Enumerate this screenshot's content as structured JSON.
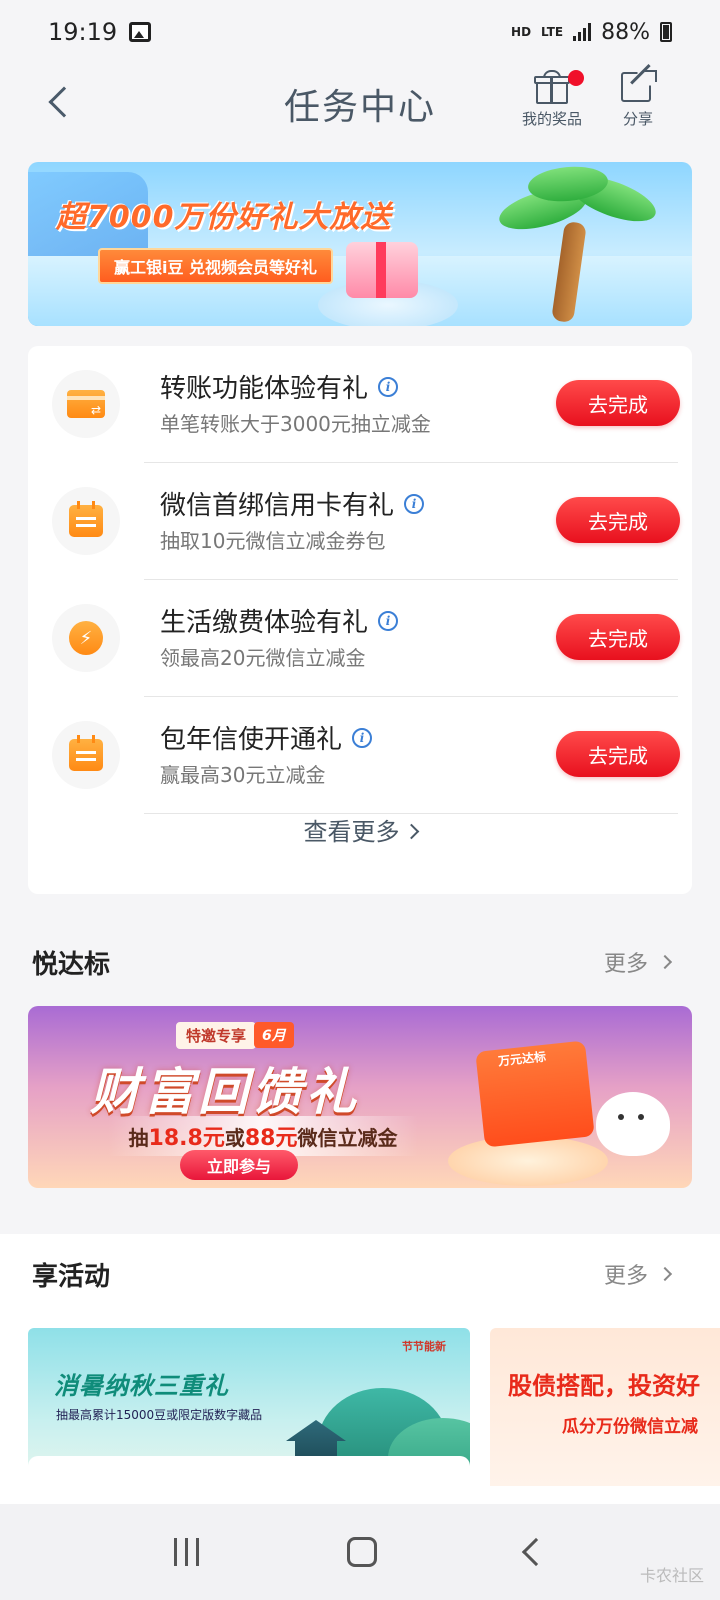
{
  "status_bar": {
    "time": "19:19",
    "hd": "HD",
    "network": "LTE",
    "battery": "88%"
  },
  "header": {
    "title": "任务中心",
    "prizes_label": "我的奖品",
    "share_label": "分享"
  },
  "top_banner": {
    "title": "超7000万份好礼大放送",
    "subtitle": "赢工银i豆 兑视频会员等好礼"
  },
  "tasks": [
    {
      "title": "转账功能体验有礼",
      "desc": "单笔转账大于3000元抽立减金",
      "button": "去完成",
      "icon": "card-transfer-icon"
    },
    {
      "title": "微信首绑信用卡有礼",
      "desc": "抽取10元微信立减金券包",
      "button": "去完成",
      "icon": "calendar-icon"
    },
    {
      "title": "生活缴费体验有礼",
      "desc": "领最高20元微信立减金",
      "button": "去完成",
      "icon": "lightning-drop-icon"
    },
    {
      "title": "包年信使开通礼",
      "desc": "赢最高30元立减金",
      "button": "去完成",
      "icon": "calendar-icon"
    }
  ],
  "see_more": "查看更多",
  "section_yue": {
    "title": "悦达标",
    "more": "更多"
  },
  "wealth_banner": {
    "tag": "特邀专享",
    "month": "6月",
    "title": "财富回馈礼",
    "desc_prefix": "抽",
    "amount1": "18.8元",
    "desc_mid": "或",
    "amount2": "88元",
    "desc_suffix": "微信立减金",
    "button": "立即参与",
    "box_label": "万元达标"
  },
  "section_activities": {
    "title": "享活动",
    "more": "更多"
  },
  "activities": [
    {
      "title": "消暑纳秋三重礼",
      "subtitle": "抽最高累计15000豆或限定版数字藏品",
      "badge": "节节能新"
    },
    {
      "title": "股债搭配，投资好",
      "subtitle": "瓜分万份微信立减"
    }
  ],
  "watermark": "卡农社区"
}
